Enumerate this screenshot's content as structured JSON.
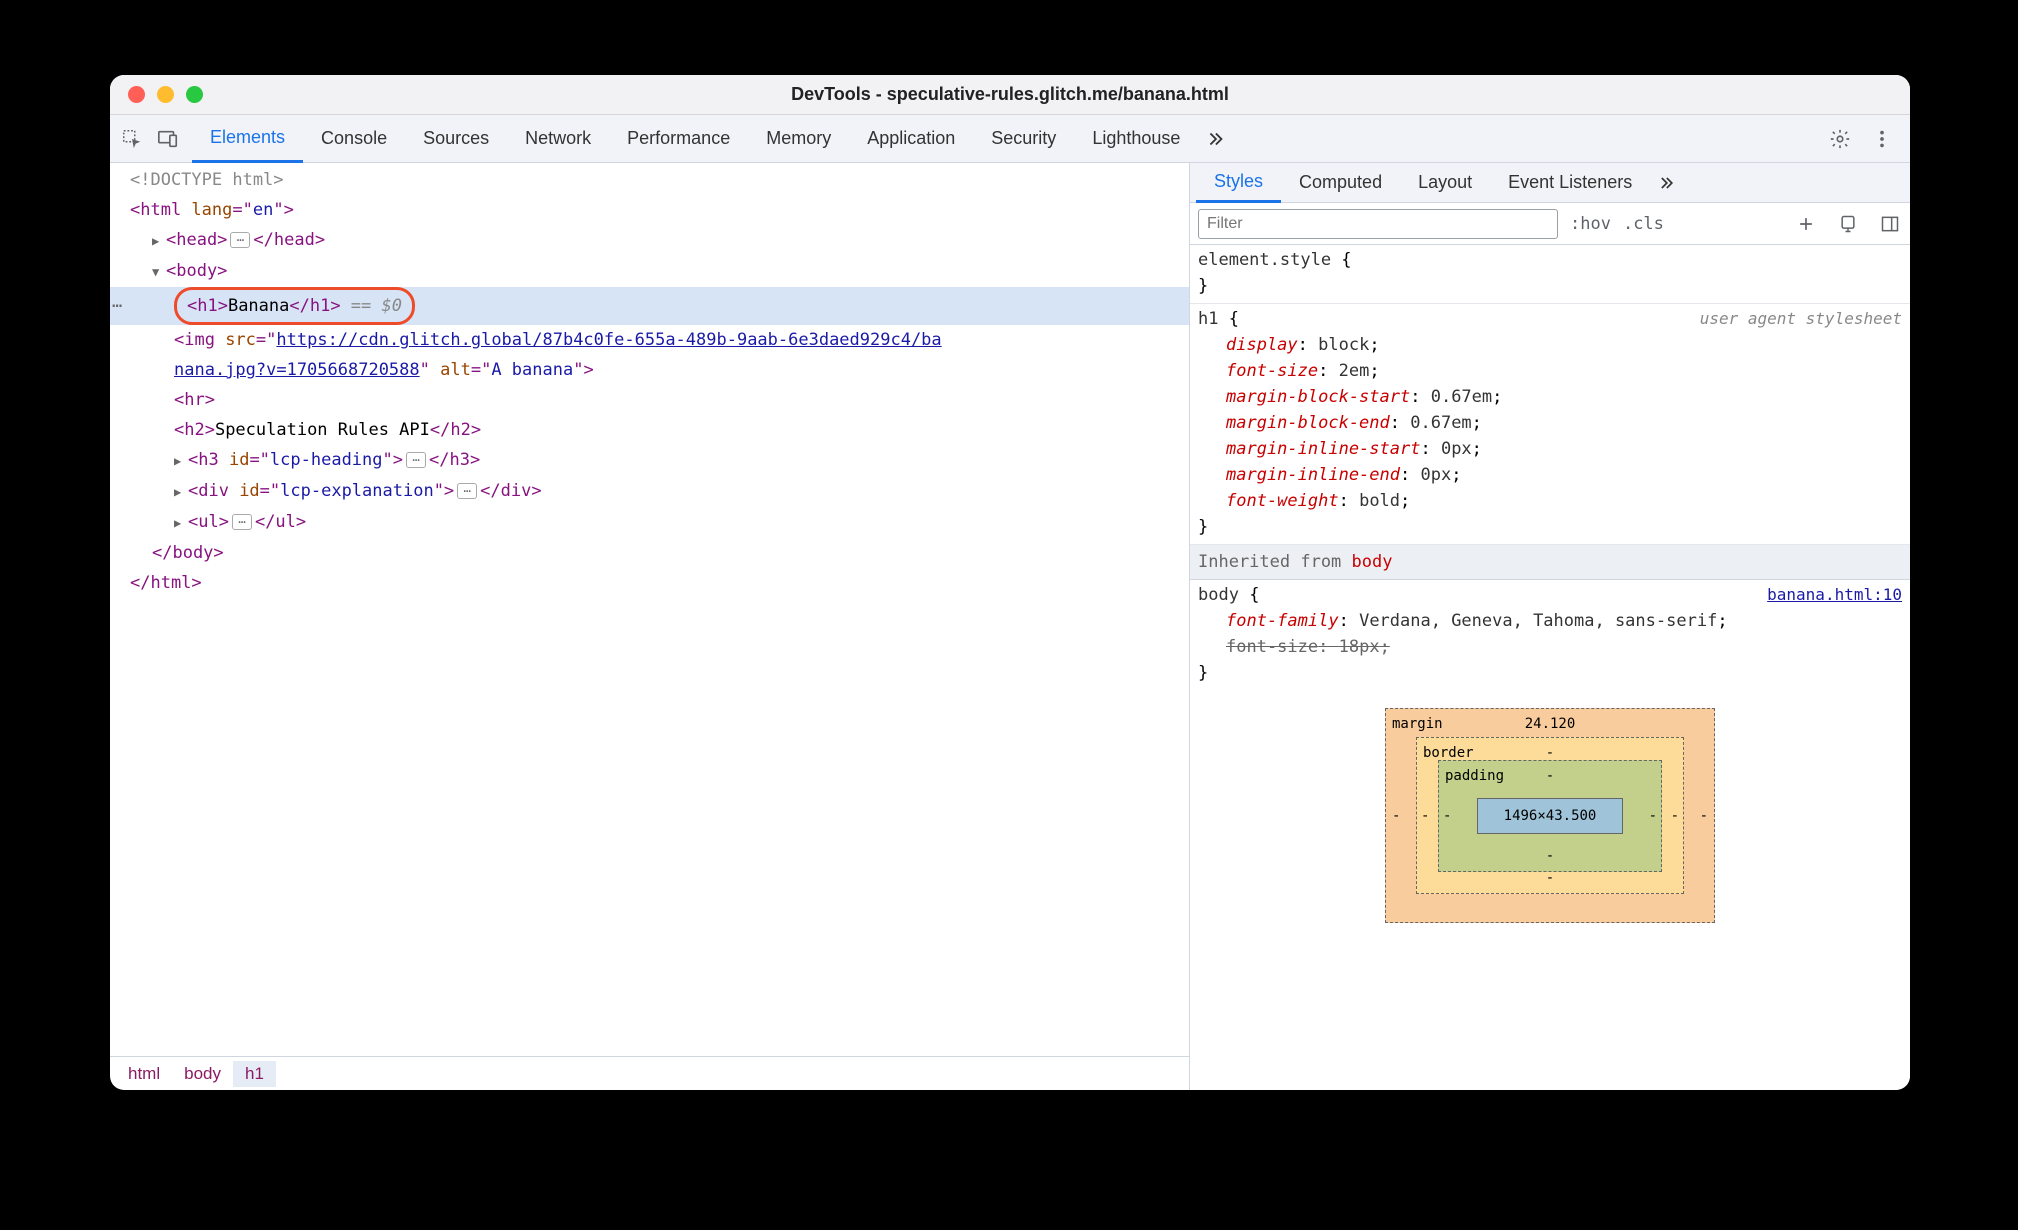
{
  "window": {
    "title": "DevTools - speculative-rules.glitch.me/banana.html"
  },
  "main_tabs": [
    "Elements",
    "Console",
    "Sources",
    "Network",
    "Performance",
    "Memory",
    "Application",
    "Security",
    "Lighthouse"
  ],
  "main_tab_active_index": 0,
  "dom": {
    "doctype": "<!DOCTYPE html>",
    "html_open": "<html lang=\"en\">",
    "head_open": "<head>",
    "head_close": "</head>",
    "body_open": "<body>",
    "h1_open": "<h1>",
    "h1_text": "Banana",
    "h1_close": "</h1>",
    "h1_console_ref": " == $0",
    "img_prefix": "<img src=\"",
    "img_src_line1": "https://cdn.glitch.global/87b4c0fe-655a-489b-9aab-6e3daed929c4/ba",
    "img_src_line2": "nana.jpg?v=1705668720588",
    "img_after_src": "\" alt=\"",
    "img_alt": "A banana",
    "img_suffix": "\">",
    "hr": "<hr>",
    "h2_open": "<h2>",
    "h2_text": "Speculation Rules API",
    "h2_close": "</h2>",
    "h3_open": "<h3 id=\"",
    "h3_id": "lcp-heading",
    "h3_close_open": "\">",
    "h3_close": "</h3>",
    "div_open": "<div id=\"",
    "div_id": "lcp-explanation",
    "div_close_open": "\">",
    "div_close": "</div>",
    "ul_open": "<ul>",
    "ul_close": "</ul>",
    "body_close": "</body>",
    "html_close": "</html>"
  },
  "breadcrumb": [
    "html",
    "body",
    "h1"
  ],
  "styles_tabs": [
    "Styles",
    "Computed",
    "Layout",
    "Event Listeners"
  ],
  "styles_tab_active_index": 0,
  "filter_placeholder": "Filter",
  "hov_label": ":hov",
  "cls_label": ".cls",
  "styles": {
    "element_style": {
      "selector": "element.style",
      "open": " {",
      "close": "}"
    },
    "h1_rule": {
      "selector": "h1",
      "open": " {",
      "source": "user agent stylesheet",
      "props": [
        {
          "name": "display",
          "value": "block"
        },
        {
          "name": "font-size",
          "value": "2em"
        },
        {
          "name": "margin-block-start",
          "value": "0.67em"
        },
        {
          "name": "margin-block-end",
          "value": "0.67em"
        },
        {
          "name": "margin-inline-start",
          "value": "0px"
        },
        {
          "name": "margin-inline-end",
          "value": "0px"
        },
        {
          "name": "font-weight",
          "value": "bold"
        }
      ],
      "close": "}"
    },
    "inherited_label": "Inherited from ",
    "inherited_from": "body",
    "body_rule": {
      "selector": "body",
      "open": " {",
      "source": "banana.html:10",
      "props": [
        {
          "name": "font-family",
          "value": "Verdana, Geneva, Tahoma, sans-serif",
          "struck": false
        },
        {
          "name": "font-size",
          "value": "18px",
          "struck": true
        }
      ],
      "close": "}"
    }
  },
  "box_model": {
    "margin_label": "margin",
    "margin_top": "24.120",
    "border_label": "border",
    "padding_label": "padding",
    "content": "1496×43.500",
    "dash": "-"
  }
}
